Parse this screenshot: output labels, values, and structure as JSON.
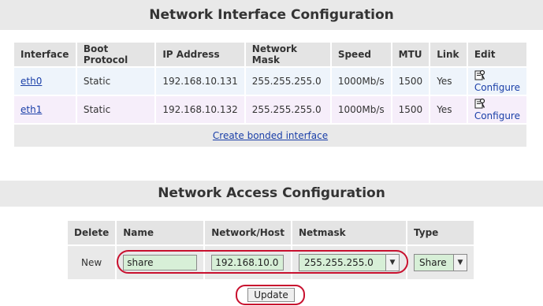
{
  "interfaces_section": {
    "title": "Network Interface Configuration",
    "columns": [
      "Interface",
      "Boot Protocol",
      "IP Address",
      "Network Mask",
      "Speed",
      "MTU",
      "Link",
      "Edit"
    ],
    "rows": [
      {
        "interface": "eth0",
        "boot_protocol": "Static",
        "ip": "192.168.10.131",
        "mask": "255.255.255.0",
        "speed": "1000Mb/s",
        "mtu": "1500",
        "link": "Yes",
        "edit_label": "Configure",
        "edit_icon": "configure-icon"
      },
      {
        "interface": "eth1",
        "boot_protocol": "Static",
        "ip": "192.168.10.132",
        "mask": "255.255.255.0",
        "speed": "1000Mb/s",
        "mtu": "1500",
        "link": "Yes",
        "edit_label": "Configure",
        "edit_icon": "configure-icon"
      }
    ],
    "bonded_link": "Create bonded interface"
  },
  "access_section": {
    "title": "Network Access Configuration",
    "columns": [
      "Delete",
      "Name",
      "Network/Host",
      "Netmask",
      "Type"
    ],
    "new_row": {
      "delete_label": "New",
      "name_value": "share",
      "network_value": "192.168.10.0",
      "netmask_value": "255.255.255.0",
      "type_value": "Share"
    },
    "update_label": "Update"
  },
  "colors": {
    "row_a_bg": "#eef4fb",
    "row_b_bg": "#f6eefa",
    "input_bg": "#d7efd7",
    "link": "#1a3fa8",
    "highlight_oval": "#c8102e"
  }
}
